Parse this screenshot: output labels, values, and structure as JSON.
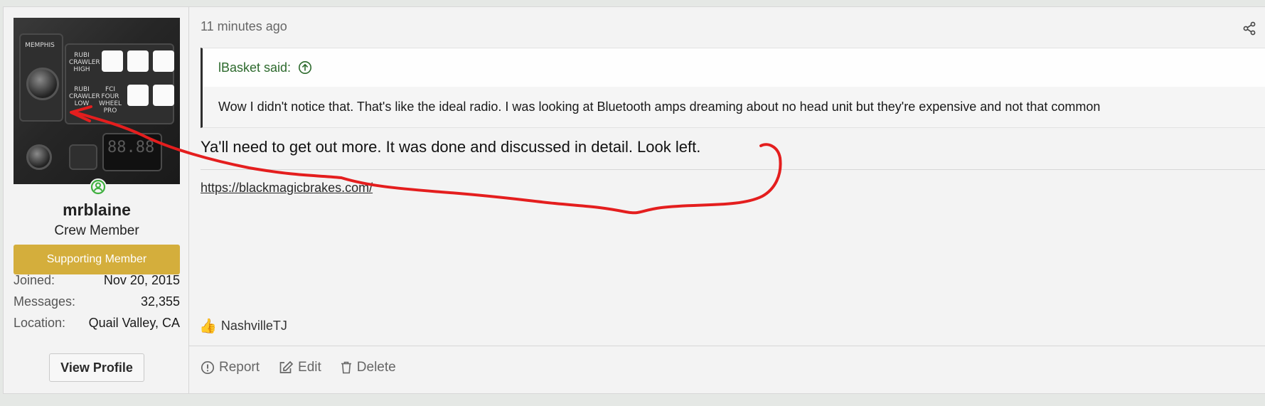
{
  "user": {
    "name": "mrblaine",
    "title": "Crew Member",
    "banner": "Supporting Member",
    "online_icon": "user-circle-icon",
    "avatar_text": {
      "brand": "MEMPHIS",
      "switch1": "RUBI CRAWLER HIGH",
      "switch2": "RUBI CRAWLER LOW",
      "switch3": "FCI FOUR WHEEL PRO",
      "display": "88.88"
    },
    "info": [
      {
        "key": "Joined:",
        "value": "Nov 20, 2015"
      },
      {
        "key": "Messages:",
        "value": "32,355"
      },
      {
        "key": "Location:",
        "value": "Quail Valley, CA"
      }
    ],
    "view_profile": "View Profile"
  },
  "post": {
    "time": "11 minutes ago",
    "share_icon": "share-icon",
    "quote": {
      "author": "lBasket said:",
      "jump_icon": "arrow-up-circle-icon",
      "text": "Wow I didn't notice that. That's like the ideal radio. I was looking at Bluetooth amps dreaming about no head unit but they're expensive and not that common"
    },
    "message": "Ya'll need to get out more. It was done and discussed in detail. Look left.",
    "signature_link": "https://blackmagicbrakes.com/",
    "reactions": {
      "icon": "thumbs-up-icon",
      "users": "NashvilleTJ"
    },
    "actions": [
      {
        "label": "Report",
        "icon": "alert-circle-icon"
      },
      {
        "label": "Edit",
        "icon": "edit-icon"
      },
      {
        "label": "Delete",
        "icon": "trash-icon"
      }
    ]
  },
  "colors": {
    "banner_bg": "#d4ae3c",
    "online_green": "#3fb03f",
    "quote_author": "#2d6a2d",
    "annotation_red": "#e41e1e"
  }
}
